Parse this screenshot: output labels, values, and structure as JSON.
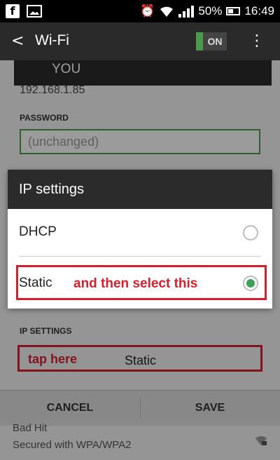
{
  "status_bar": {
    "battery_percent": "50%",
    "time": "16:49",
    "icons": [
      "facebook-icon",
      "image-icon",
      "alarm-icon",
      "wifi-icon",
      "signal-icon",
      "battery-icon"
    ]
  },
  "action_bar": {
    "title": "Wi-Fi",
    "toggle_label": "ON"
  },
  "background_form": {
    "network_header": "YOU",
    "ip_address": "192.168.1.85",
    "password_label": "PASSWORD",
    "password_value": "(unchanged)",
    "ip_settings_label": "IP SETTINGS",
    "ip_settings_value": "Static",
    "tap_annotation": "tap here",
    "cancel_label": "CANCEL",
    "save_label": "SAVE",
    "network_name": "Bad Hit",
    "network_security": "Secured with WPA/WPA2"
  },
  "dialog": {
    "title": "IP settings",
    "options": [
      {
        "label": "DHCP",
        "selected": false
      },
      {
        "label": "Static",
        "selected": true
      }
    ],
    "static_annotation": "and then select this"
  },
  "colors": {
    "annotation_red": "#d4202e",
    "accent_green": "#3aa05a"
  }
}
